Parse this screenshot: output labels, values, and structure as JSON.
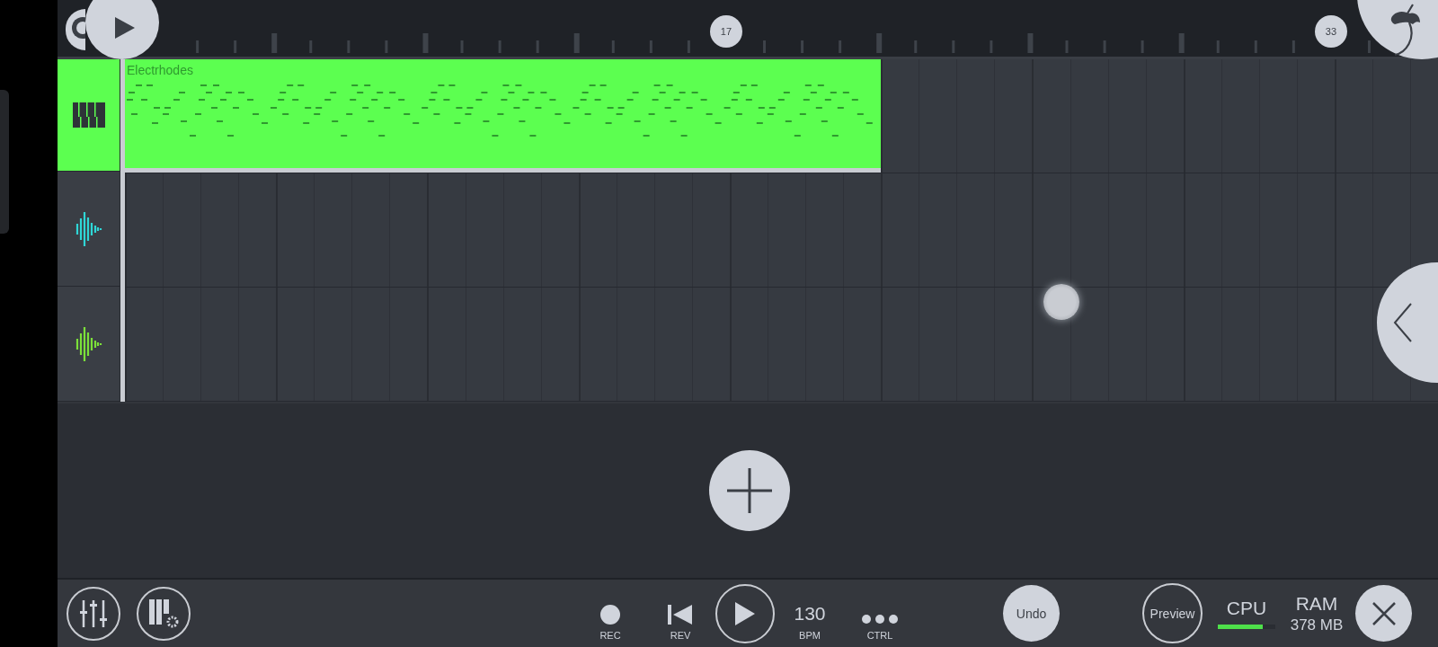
{
  "ruler": {
    "markers": [
      "17",
      "33"
    ]
  },
  "tracks": [
    {
      "kind": "pattern",
      "selected": true,
      "color": "#5cff50",
      "clip": {
        "label": "Electrhodes"
      }
    },
    {
      "kind": "audio",
      "selected": false,
      "color": "#2fd6d6"
    },
    {
      "kind": "audio",
      "selected": false,
      "color": "#7be03a"
    }
  ],
  "transport": {
    "rec": "REC",
    "rev": "REV",
    "tempo": "130",
    "tempo_label": "BPM",
    "ctrl": "CTRL",
    "undo": "Undo",
    "preview": "Preview"
  },
  "cpu": {
    "label": "CPU",
    "level": 0.78
  },
  "ram": {
    "label": "RAM",
    "value": "378 MB"
  }
}
